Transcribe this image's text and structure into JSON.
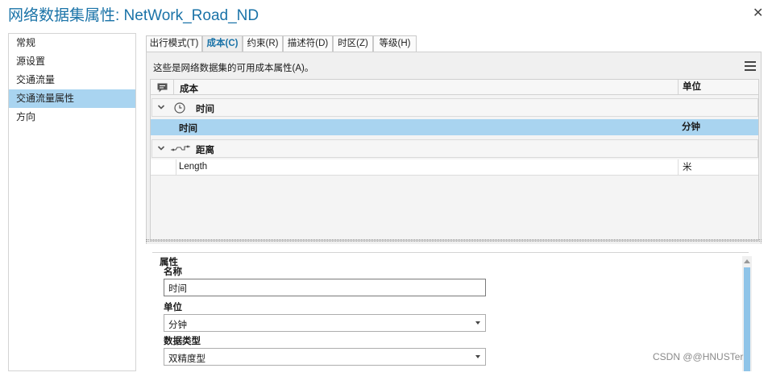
{
  "window": {
    "title": "网络数据集属性: NetWork_Road_ND",
    "close_glyph": "✕"
  },
  "nav": {
    "items": [
      {
        "label": "常规"
      },
      {
        "label": "源设置"
      },
      {
        "label": "交通流量"
      },
      {
        "label": "交通流量属性",
        "selected": true
      },
      {
        "label": "方向"
      }
    ]
  },
  "tabs": [
    {
      "label": "出行模式(T)"
    },
    {
      "label": "成本(C)",
      "active": true
    },
    {
      "label": "约束(R)"
    },
    {
      "label": "描述符(D)"
    },
    {
      "label": "时区(Z)"
    },
    {
      "label": "等级(H)"
    }
  ],
  "cost_panel": {
    "description": "这些是网络数据集的可用成本属性(A)。",
    "columns": {
      "name": "成本",
      "unit": "单位"
    },
    "groups": [
      {
        "label": "时间",
        "icon": "clock-icon",
        "rows": [
          {
            "name": "时间",
            "unit": "分钟",
            "selected": true
          }
        ]
      },
      {
        "label": "距离",
        "icon": "distance-icon",
        "rows": [
          {
            "name": "Length",
            "unit": "米",
            "selected": false
          }
        ]
      }
    ]
  },
  "properties": {
    "legend": "属性",
    "name_label": "名称",
    "name_value": "时间",
    "unit_label": "单位",
    "unit_value": "分钟",
    "type_label": "数据类型",
    "type_value": "双精度型"
  },
  "watermark": "CSDN @@HNUSTer",
  "colors": {
    "accent": "#1a73a8",
    "selection": "#a9d4f0",
    "scroll_thumb": "#8fc4e8"
  }
}
